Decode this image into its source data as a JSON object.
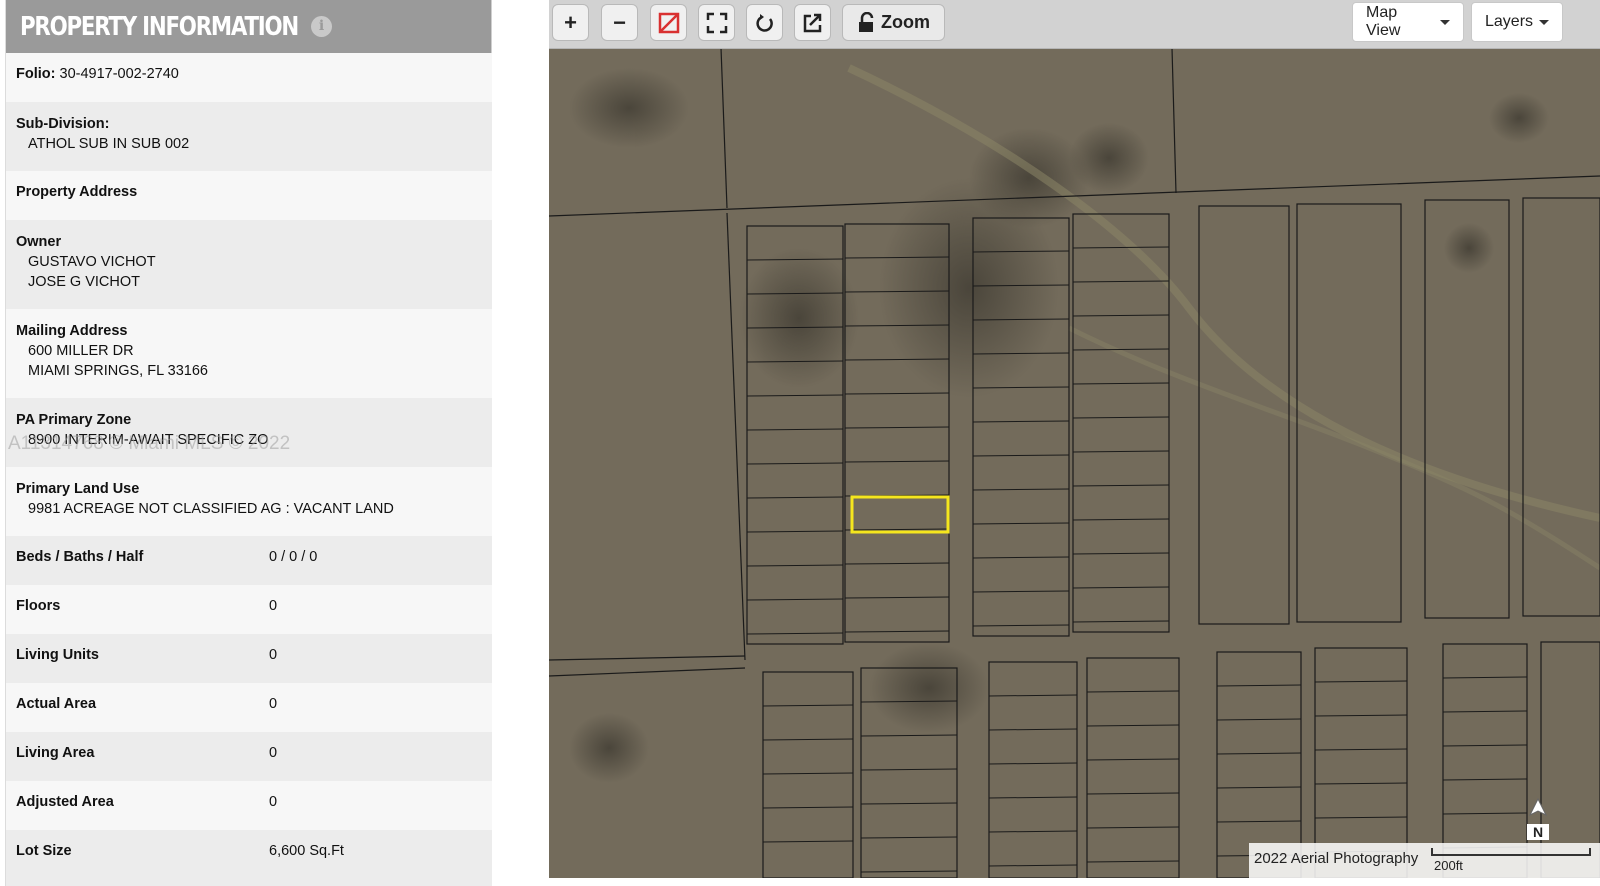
{
  "panel": {
    "title": "PROPERTY INFORMATION",
    "info_icon": "info-icon",
    "folio": {
      "label": "Folio:",
      "value": "30-4917-002-2740"
    },
    "subdivision": {
      "label": "Sub-Division:",
      "value": "ATHOL SUB IN SUB 002"
    },
    "property_address": {
      "label": "Property Address"
    },
    "owner": {
      "label": "Owner",
      "values": [
        "GUSTAVO VICHOT",
        "JOSE G VICHOT"
      ]
    },
    "mailing_address": {
      "label": "Mailing Address",
      "values": [
        "600 MILLER DR",
        "MIAMI SPRINGS, FL 33166"
      ]
    },
    "pa_primary_zone": {
      "label": "PA Primary Zone",
      "value": "8900 INTERIM-AWAIT SPECIFIC ZO"
    },
    "primary_land_use": {
      "label": "Primary Land Use",
      "value": "9981 ACREAGE NOT CLASSIFIED AG : VACANT LAND"
    },
    "details": [
      {
        "label": "Beds / Baths / Half",
        "value": "0 / 0 / 0"
      },
      {
        "label": "Floors",
        "value": "0"
      },
      {
        "label": "Living Units",
        "value": "0"
      },
      {
        "label": "Actual Area",
        "value": "0"
      },
      {
        "label": "Living Area",
        "value": "0"
      },
      {
        "label": "Adjusted Area",
        "value": "0"
      },
      {
        "label": "Lot Size",
        "value": "6,600 Sq.Ft"
      }
    ]
  },
  "watermark": "A11314768 © Miami MLS © 2022",
  "map": {
    "toolbar": {
      "zoom_in": "+",
      "zoom_out": "−",
      "zoom_label": "Zoom",
      "map_view_label": "Map View",
      "layers_label": "Layers"
    },
    "attribution": "2022 Aerial Photography",
    "scale_label": "200ft",
    "north_label": "N",
    "highlight_color": "#f5e61e",
    "parcel_line_color": "#1a1a1a",
    "imagery_color": "#6e6759"
  }
}
